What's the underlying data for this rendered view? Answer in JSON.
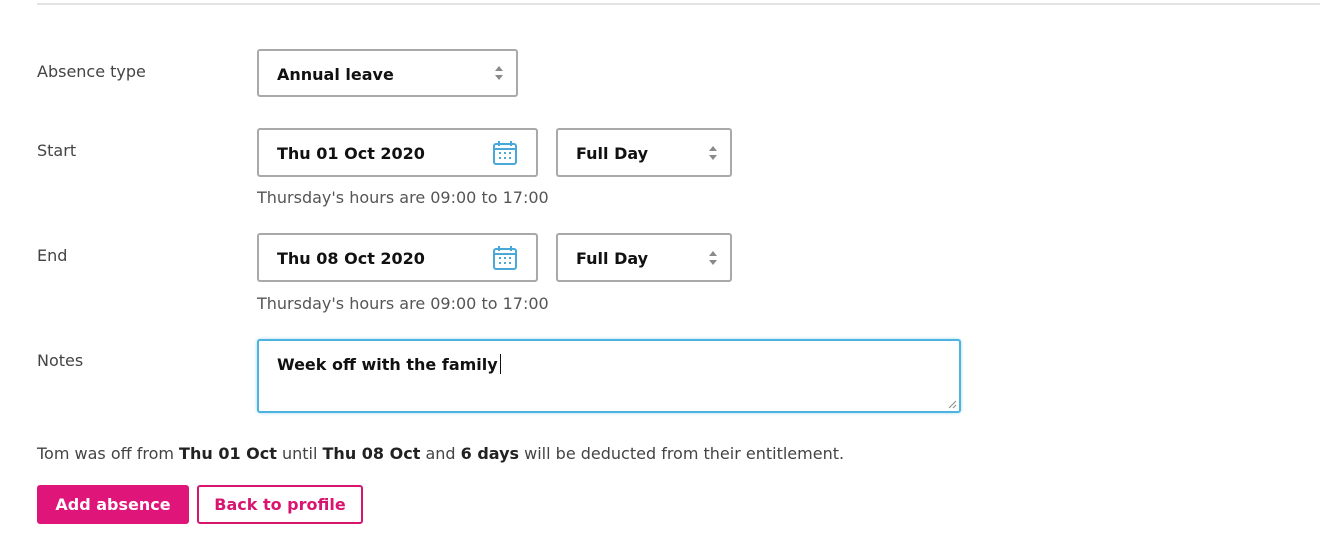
{
  "form": {
    "absence_type": {
      "label": "Absence type",
      "value": "Annual leave"
    },
    "start": {
      "label": "Start",
      "date": "Thu 01 Oct 2020",
      "period": "Full Day",
      "hint": "Thursday's hours are 09:00 to 17:00"
    },
    "end": {
      "label": "End",
      "date": "Thu 08 Oct 2020",
      "period": "Full Day",
      "hint": "Thursday's hours are 09:00 to 17:00"
    },
    "notes": {
      "label": "Notes",
      "value": "Week off with the family"
    }
  },
  "summary": {
    "part1": "Tom was off from ",
    "start": "Thu 01 Oct",
    "part2": " until ",
    "end": "Thu 08 Oct",
    "part3": " and ",
    "days": "6 days",
    "part4": " will be deducted from their entitlement."
  },
  "actions": {
    "add_label": "Add absence",
    "back_label": "Back to profile"
  },
  "colors": {
    "accent": "#e0157a",
    "focus": "#4db3e0",
    "calendar_icon": "#4aa8d8"
  },
  "icons": {
    "calendar": "calendar-icon",
    "select_arrows": "select-arrows-icon",
    "resize": "resize-handle-icon"
  }
}
